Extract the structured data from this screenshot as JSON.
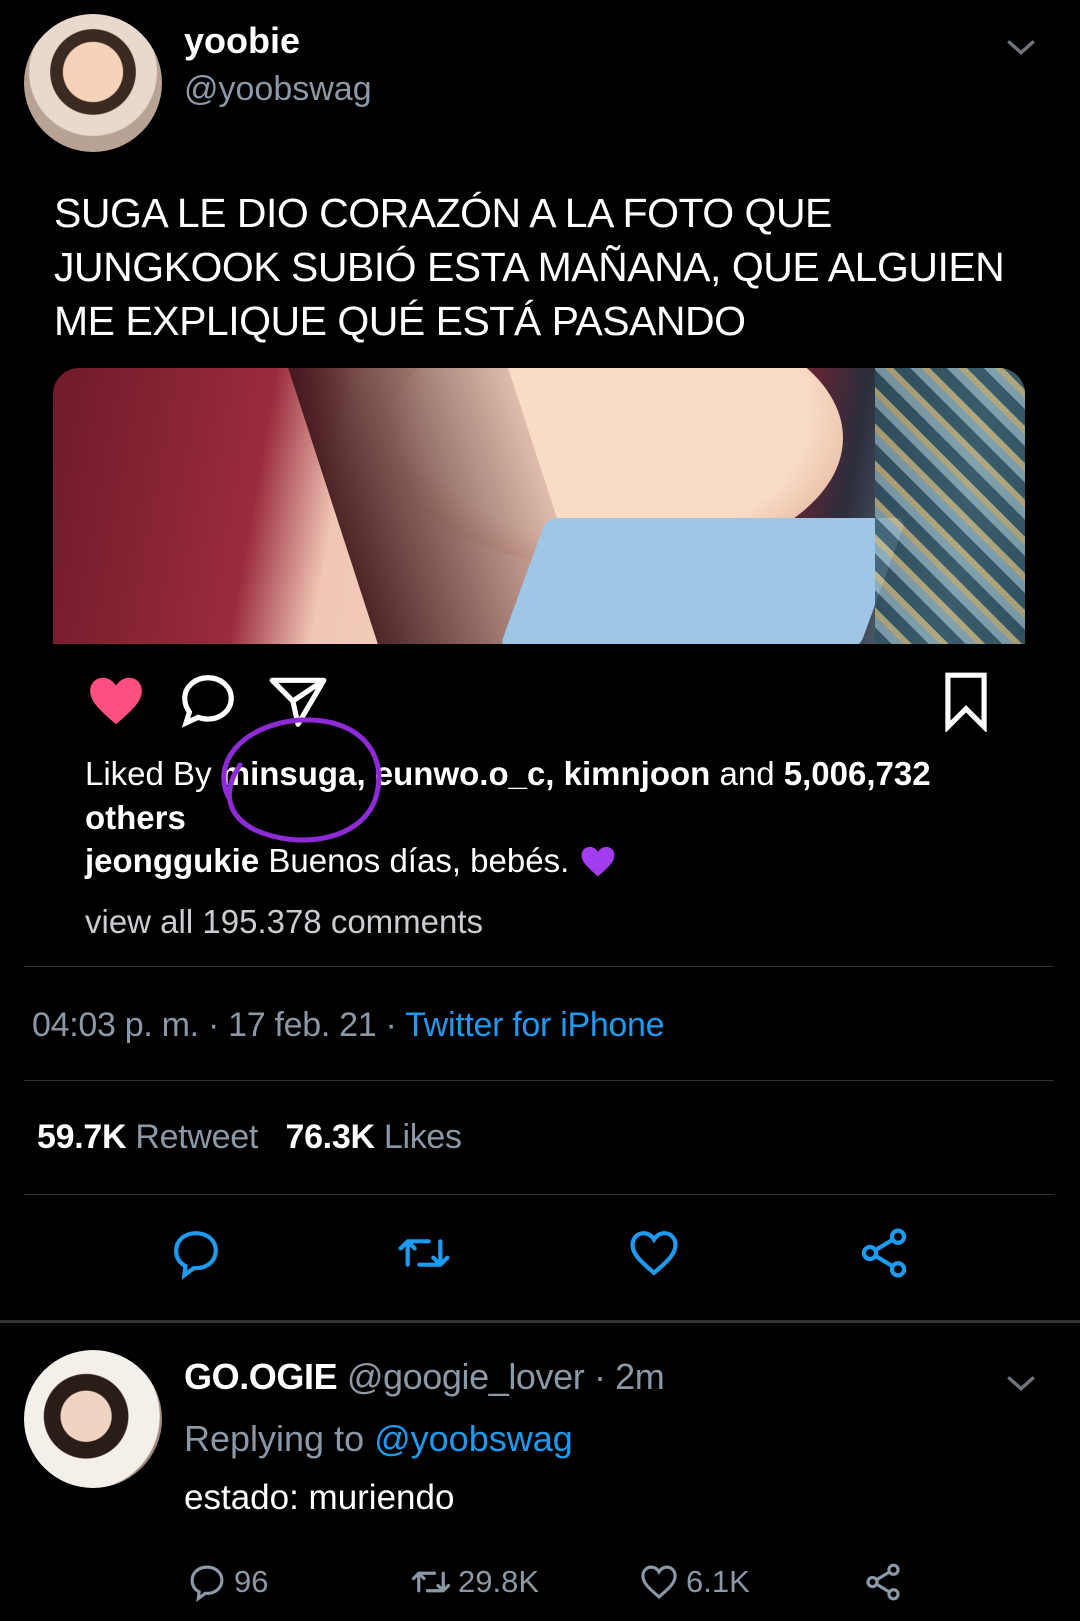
{
  "tweet": {
    "display_name": "yoobie",
    "handle": "@yoobswag",
    "text": "SUGA LE DIO CORAZÓN A LA FOTO QUE JUNGKOOK SUBIÓ ESTA MAÑANA, QUE ALGUIEN ME EXPLIQUE QUÉ ESTÁ PASANDO",
    "embed": {
      "liked_prefix": "Liked By ",
      "liked_user_1": "minsuga,",
      "liked_user_2": "eunwo.o_c,",
      "liked_user_3": "kimnjoon",
      "liked_and": " and ",
      "liked_count": "5,006,732 others",
      "caption_user": "jeonggukie",
      "caption_text": " Buenos días, bebés. ",
      "view_all": "view all 195.378 comments"
    },
    "time": "04:03 p. m.",
    "dot": " · ",
    "date": "17 feb. 21",
    "app": "Twitter for iPhone",
    "retweet_count": "59.7K",
    "retweet_label": " Retweet",
    "likes_count": "76.3K",
    "likes_label": " Likes"
  },
  "reply": {
    "display_name": "GO.OGIE",
    "handle": "@googie_lover",
    "time": "· 2m",
    "replying_label": "Replying to ",
    "replying_to": "@yoobswag",
    "text": "estado: muriendo",
    "replies": "96",
    "retweets": "29.8K",
    "likes": "6.1K"
  },
  "colors": {
    "accent_blue": "#1d9bf0",
    "heart_pink": "#ff4f80",
    "circle_purple": "#8e2bd6",
    "muted": "#8b98a5"
  }
}
